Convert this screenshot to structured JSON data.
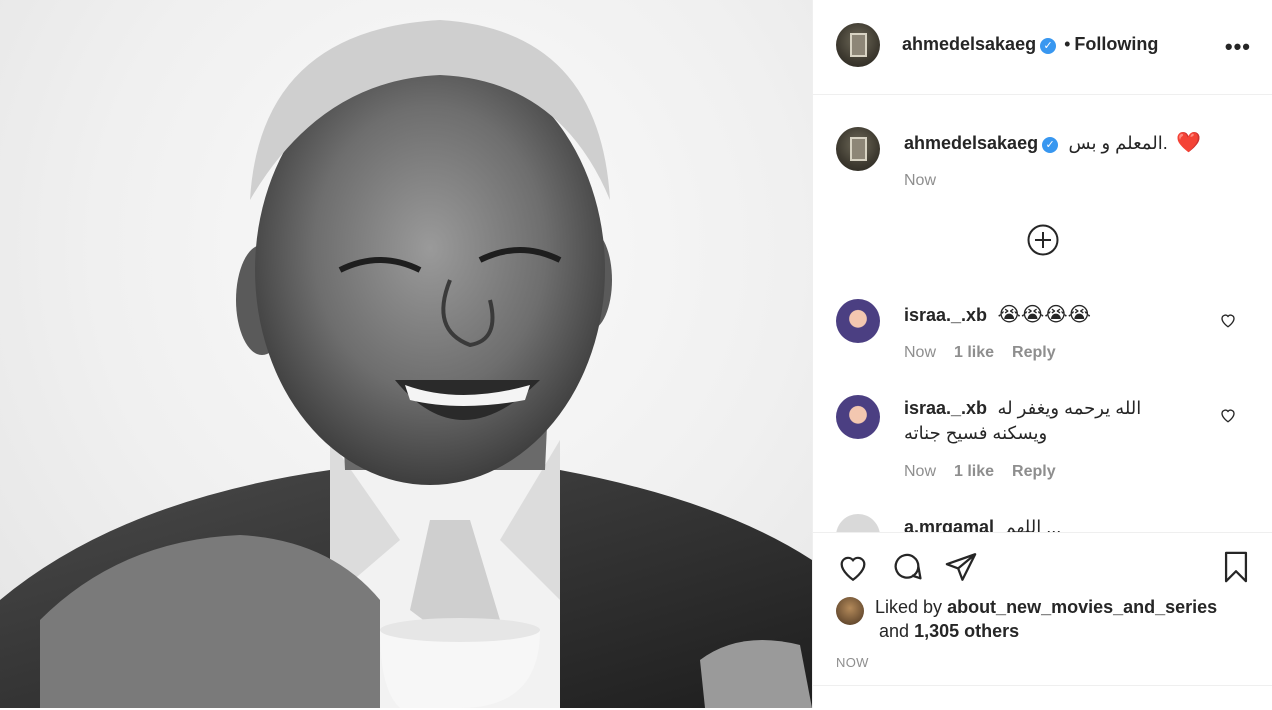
{
  "post": {
    "image_alt": "Black and white portrait of a smiling man holding a teacup"
  },
  "header": {
    "username": "ahmedelsakaeg",
    "verified_icon": "verified-badge-icon",
    "separator": "•",
    "follow_status": "Following",
    "more_icon": "more-options-icon",
    "more_label": "•••"
  },
  "caption": {
    "username": "ahmedelsakaeg",
    "text": "المعلم و بس.",
    "emoji": "❤️",
    "time": "Now"
  },
  "load_more": {
    "icon": "plus-circle-icon"
  },
  "comments": [
    {
      "username": "israa._.xb",
      "text": "😭😭😭😭",
      "time": "Now",
      "likes": "1 like",
      "reply": "Reply"
    },
    {
      "username": "israa._.xb",
      "text": "الله يرحمه ويغفر له",
      "text2": "ويسكنه فسيح جناته",
      "time": "Now",
      "likes": "1 like",
      "reply": "Reply"
    },
    {
      "username": "a.mrgamal",
      "text": "اللهم ...",
      "partial": true
    }
  ],
  "actions": {
    "like_icon": "heart-icon",
    "comment_icon": "comment-icon",
    "share_icon": "send-icon",
    "save_icon": "bookmark-icon"
  },
  "likes": {
    "prefix": "Liked by",
    "user": "about_new_movies_and_series",
    "and": "and",
    "others": "1,305 others"
  },
  "timestamp": "NOW",
  "colors": {
    "text": "#262626",
    "muted": "#8e8e8e",
    "verified": "#3897f0",
    "heart": "#ed4956"
  }
}
